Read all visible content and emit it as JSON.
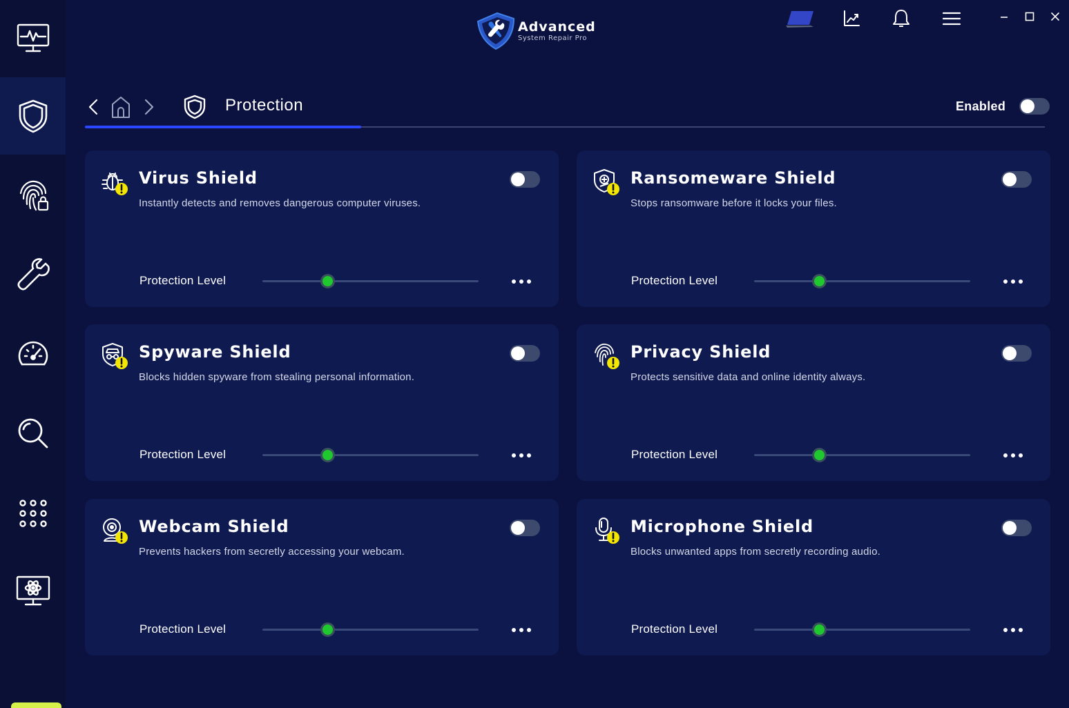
{
  "app": {
    "title": "Advanced",
    "subtitle": "System Repair Pro"
  },
  "colors": {
    "background": "#0c1240",
    "card": "#0e1a50",
    "accent": "#2a47ff",
    "slider_knob": "#1ec82e",
    "warning": "#f3e600"
  },
  "sidebar": {
    "items": [
      {
        "name": "activity-monitor-icon"
      },
      {
        "name": "shield-icon"
      },
      {
        "name": "fingerprint-lock-icon"
      },
      {
        "name": "wrench-icon"
      },
      {
        "name": "speedometer-icon"
      },
      {
        "name": "search-icon"
      },
      {
        "name": "apps-grid-icon"
      },
      {
        "name": "monitor-atom-icon"
      }
    ],
    "active_index": 1
  },
  "topbar": {
    "icons": [
      "laptop-icon",
      "chart-icon",
      "bell-icon",
      "menu-icon"
    ],
    "window": [
      "minimize-icon",
      "maximize-icon",
      "close-icon"
    ]
  },
  "header": {
    "title": "Protection",
    "enabled_label": "Enabled",
    "enabled": false
  },
  "cards": [
    {
      "title": "Virus Shield",
      "description": "Instantly detects and removes dangerous computer viruses.",
      "level_label": "Protection Level",
      "level": 0.3,
      "enabled": false,
      "icon": "virus-bug-icon"
    },
    {
      "title": "Ransomeware Shield",
      "description": "Stops ransomware before it locks your files.",
      "level_label": "Protection Level",
      "level": 0.3,
      "enabled": false,
      "icon": "ransomware-shield-icon"
    },
    {
      "title": "Spyware Shield",
      "description": "Blocks hidden spyware from stealing personal information.",
      "level_label": "Protection Level",
      "level": 0.3,
      "enabled": false,
      "icon": "spyware-shield-icon"
    },
    {
      "title": "Privacy Shield",
      "description": "Protects sensitive data and online identity always.",
      "level_label": "Protection Level",
      "level": 0.3,
      "enabled": false,
      "icon": "fingerprint-icon"
    },
    {
      "title": "Webcam Shield",
      "description": "Prevents hackers from secretly accessing your webcam.",
      "level_label": "Protection Level",
      "level": 0.3,
      "enabled": false,
      "icon": "webcam-icon"
    },
    {
      "title": "Microphone Shield",
      "description": "Blocks unwanted apps from secretly recording audio.",
      "level_label": "Protection Level",
      "level": 0.3,
      "enabled": false,
      "icon": "microphone-icon"
    }
  ]
}
